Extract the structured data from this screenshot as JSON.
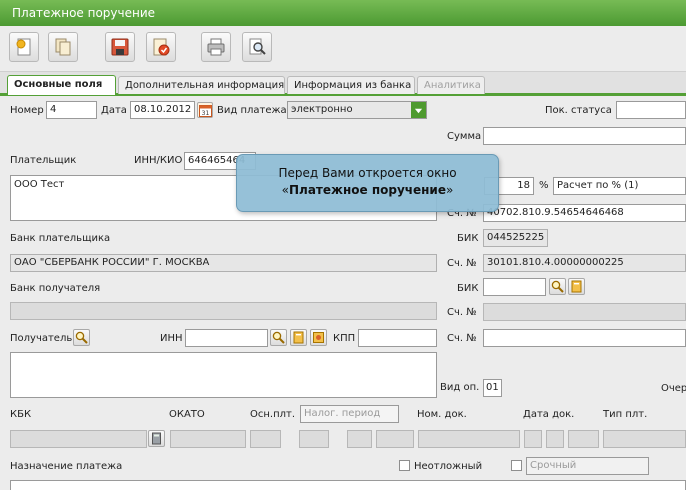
{
  "window": {
    "title": "Платежное поручение"
  },
  "toolbar": {
    "buttons": [
      {
        "name": "new-doc-icon"
      },
      {
        "name": "copy-doc-icon"
      },
      {
        "name": "save-icon"
      },
      {
        "name": "sign-doc-icon"
      },
      {
        "name": "print-icon"
      },
      {
        "name": "preview-icon"
      }
    ]
  },
  "tabs": [
    {
      "label": "Основные поля",
      "state": "active"
    },
    {
      "label": "Дополнительная информация",
      "state": "normal"
    },
    {
      "label": "Информация из банка",
      "state": "normal"
    },
    {
      "label": "Аналитика",
      "state": "disabled"
    }
  ],
  "form": {
    "number_label": "Номер",
    "number_value": "4",
    "date_label": "Дата",
    "date_value": "08.10.2012",
    "calendar_day": "31",
    "payment_type_label": "Вид платежа",
    "payment_type_value": "электронно",
    "status_label": "Пок. статуса",
    "status_value": "",
    "sum_label": "Сумма",
    "sum_value": "",
    "payer_label": "Плательщик",
    "inn_kio_label": "ИНН/КИО",
    "payer_inn": "646465464",
    "payer_name": "ООО Тест",
    "vat_value": "18",
    "vat_percent": "%",
    "vat_calc": "Расчет по % (1)",
    "account_label": "Сч. №",
    "payer_account": "40702.810.9.54654646468",
    "payer_bank_label": "Банк плательщика",
    "bik_label": "БИК",
    "payer_bank_bik": "044525225",
    "payer_bank_name": "ОАО \"СБЕРБАНК РОССИИ\" Г. МОСКВА",
    "payer_bank_account": "30101.810.4.00000000225",
    "recipient_bank_label": "Банк получателя",
    "recipient_label": "Получатель",
    "inn_label": "ИНН",
    "kpp_label": "КПП",
    "op_type_label": "Вид оп.",
    "op_type_value": "01",
    "queue_label": "Очер",
    "kbk_label": "КБК",
    "okato_label": "ОКАТО",
    "basis_label": "Осн.плт.",
    "tax_period_placeholder": "Налог. период",
    "doc_number_label": "Ном. док.",
    "doc_date_label": "Дата док.",
    "pay_type_label": "Тип плт.",
    "purpose_label": "Назначение платежа",
    "urgent_label": "Неотложный",
    "term_placeholder": "Срочный"
  },
  "tooltip": {
    "line1": "Перед Вами откроется окно",
    "quote_open": "«",
    "strong": "Платежное поручение",
    "quote_close": "»"
  },
  "colors": {
    "titlebar": "#4c9a32",
    "tab_accent": "#54a036",
    "tooltip_bg": "#8ebcd5"
  }
}
